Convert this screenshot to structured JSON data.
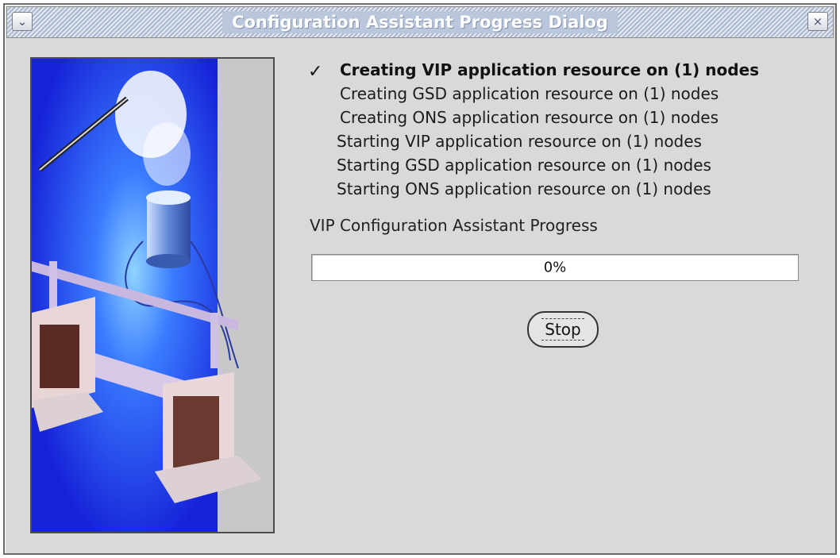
{
  "window": {
    "title": "Configuration Assistant Progress Dialog",
    "menu_icon": "chevron-down-icon",
    "close_icon": "close-icon",
    "close_glyph": "×",
    "menu_glyph": "⌄"
  },
  "steps": [
    {
      "label": "Creating VIP application resource on (1) nodes",
      "status": "in-progress",
      "check": "✓"
    },
    {
      "label": "Creating GSD application resource on (1) nodes",
      "status": "pending"
    },
    {
      "label": "Creating ONS application resource on (1) nodes",
      "status": "pending"
    },
    {
      "label": "Starting VIP application resource on (1) nodes",
      "status": "pending"
    },
    {
      "label": "Starting GSD application resource on (1) nodes",
      "status": "pending"
    },
    {
      "label": "Starting ONS application resource on (1) nodes",
      "status": "pending"
    }
  ],
  "progress": {
    "label": "VIP Configuration Assistant Progress",
    "percent": 0,
    "percent_text": "0%"
  },
  "buttons": {
    "stop_label": "Stop"
  },
  "colors": {
    "art_blue": "#1a2be0",
    "titlebar": "#c4cfe0"
  }
}
